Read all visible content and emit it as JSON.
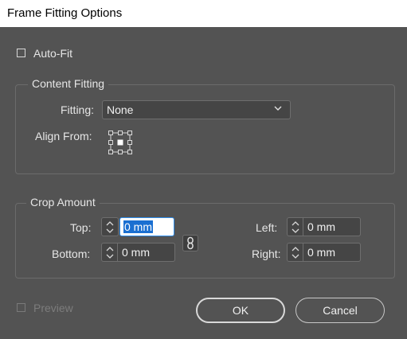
{
  "window": {
    "title": "Frame Fitting Options"
  },
  "auto_fit": {
    "label": "Auto-Fit",
    "checked": false
  },
  "content_fitting": {
    "title": "Content Fitting",
    "fitting_label": "Fitting:",
    "fitting_value": "None",
    "align_from_label": "Align From:",
    "reference_point": "center"
  },
  "crop_amount": {
    "title": "Crop Amount",
    "top_label": "Top:",
    "top_value": "0 mm",
    "bottom_label": "Bottom:",
    "bottom_value": "0 mm",
    "left_label": "Left:",
    "left_value": "0 mm",
    "right_label": "Right:",
    "right_value": "0 mm"
  },
  "preview": {
    "label": "Preview",
    "checked": false,
    "enabled": false
  },
  "buttons": {
    "ok": "OK",
    "cancel": "Cancel"
  },
  "colors": {
    "background": "#535353",
    "field": "#454545",
    "focus": "#2d8ceb",
    "selection": "#1a6fd1"
  }
}
